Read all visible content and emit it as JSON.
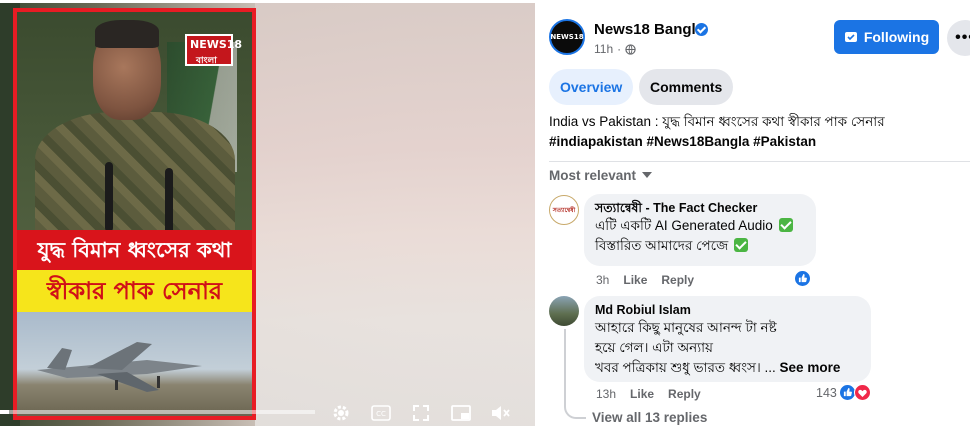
{
  "video": {
    "logo_line1": "NEWS18",
    "logo_line2": "বাংলা",
    "caption_line1": "যুদ্ধ বিমান ধ্বংসের কথা",
    "caption_line2": "স্বীকার পাক সেনার",
    "progress_fraction": 0.03,
    "controls": [
      "settings-icon",
      "captions-icon",
      "fullscreen-icon",
      "pip-icon",
      "volume-muted-icon"
    ],
    "colors": {
      "frame": "#e81c24",
      "caption_red": "#d9141b",
      "caption_yellow": "#f6e51b"
    }
  },
  "post": {
    "page_name": "News18 Bangla",
    "avatar_text": "NEWS18",
    "time": "11h",
    "follow_label": "Following",
    "more_label": "•••",
    "tabs": [
      {
        "label": "Overview",
        "active": true
      },
      {
        "label": "Comments",
        "active": false
      }
    ],
    "text": "India vs Pakistan : যুদ্ধ বিমান ধ্বংসের কথা স্বীকার পাক সেনার",
    "hashtags": "#indiapakistan #News18Bangla #Pakistan",
    "sort_label": "Most relevant"
  },
  "comments": [
    {
      "author": "সত্যান্বেষী",
      "author_tagline": " - The Fact Checker",
      "avatar_text": "সত্যান্বেষী",
      "lines": [
        "এটি একটি AI Generated Audio",
        "বিস্তারিত আমাদের পেজে"
      ],
      "time": "3h",
      "like_label": "Like",
      "reply_label": "Reply",
      "reaction_count": ""
    },
    {
      "author": "Md Robiul Islam",
      "lines": [
        "আহারে কিছু মানুষের আনন্দ টা নষ্ট",
        "হয়ে গেল। এটা অন্যায়",
        "খবর পত্রিকায় শুধু ভারত ধ্বংস। ..."
      ],
      "see_more": "See more",
      "time": "13h",
      "like_label": "Like",
      "reply_label": "Reply",
      "reaction_count": "143"
    }
  ],
  "view_replies": "View all 13 replies",
  "colors": {
    "accent": "#1b74e4",
    "secondary_text": "#65676b",
    "bubble": "#f0f2f5"
  }
}
